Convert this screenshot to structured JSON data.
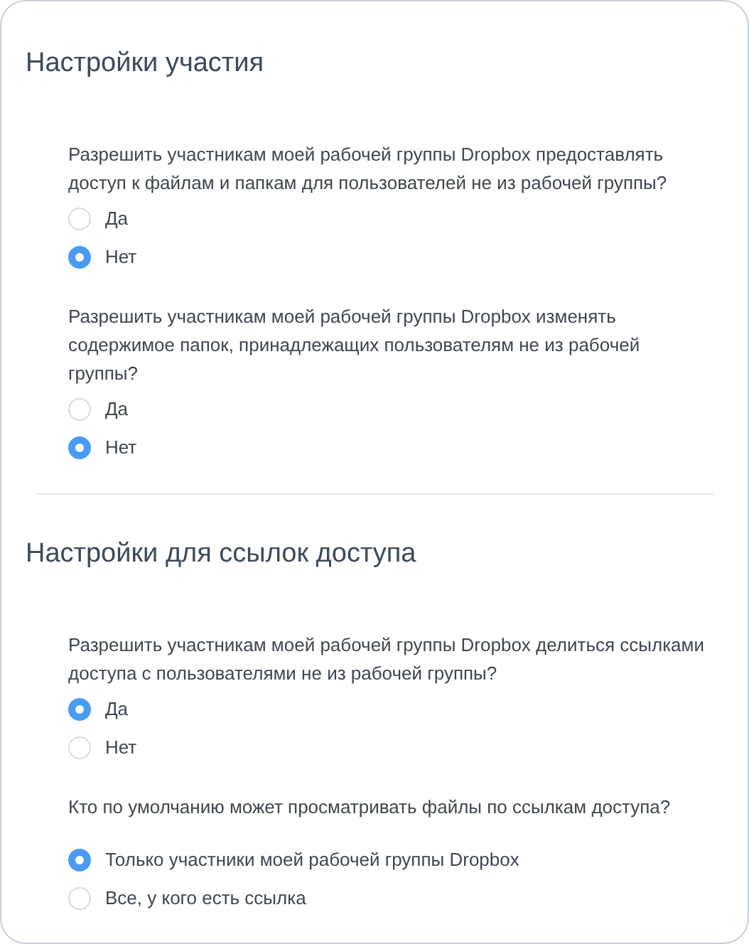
{
  "sections": [
    {
      "title": "Настройки участия",
      "questions": [
        {
          "text": "Разрешить участникам моей рабочей группы Dropbox предоставлять доступ к файлам и папкам для пользователей не из рабочей группы?",
          "options": [
            {
              "label": "Да",
              "selected": false
            },
            {
              "label": "Нет",
              "selected": true
            }
          ]
        },
        {
          "text": "Разрешить участникам моей рабочей группы Dropbox изменять содержимое папок, принадлежащих пользователям не из рабочей группы?",
          "options": [
            {
              "label": "Да",
              "selected": false
            },
            {
              "label": "Нет",
              "selected": true
            }
          ]
        }
      ]
    },
    {
      "title": "Настройки для ссылок доступа",
      "questions": [
        {
          "text": "Разрешить участникам моей рабочей группы Dropbox делиться ссылками доступа с пользователями не из рабочей группы?",
          "options": [
            {
              "label": "Да",
              "selected": true
            },
            {
              "label": "Нет",
              "selected": false
            }
          ]
        },
        {
          "text": "Кто по умолчанию может просматривать файлы по ссылкам доступа?",
          "options": [
            {
              "label": "Только участники моей рабочей группы Dropbox",
              "selected": true
            },
            {
              "label": "Все, у кого есть ссылка",
              "selected": false
            }
          ]
        }
      ]
    }
  ]
}
